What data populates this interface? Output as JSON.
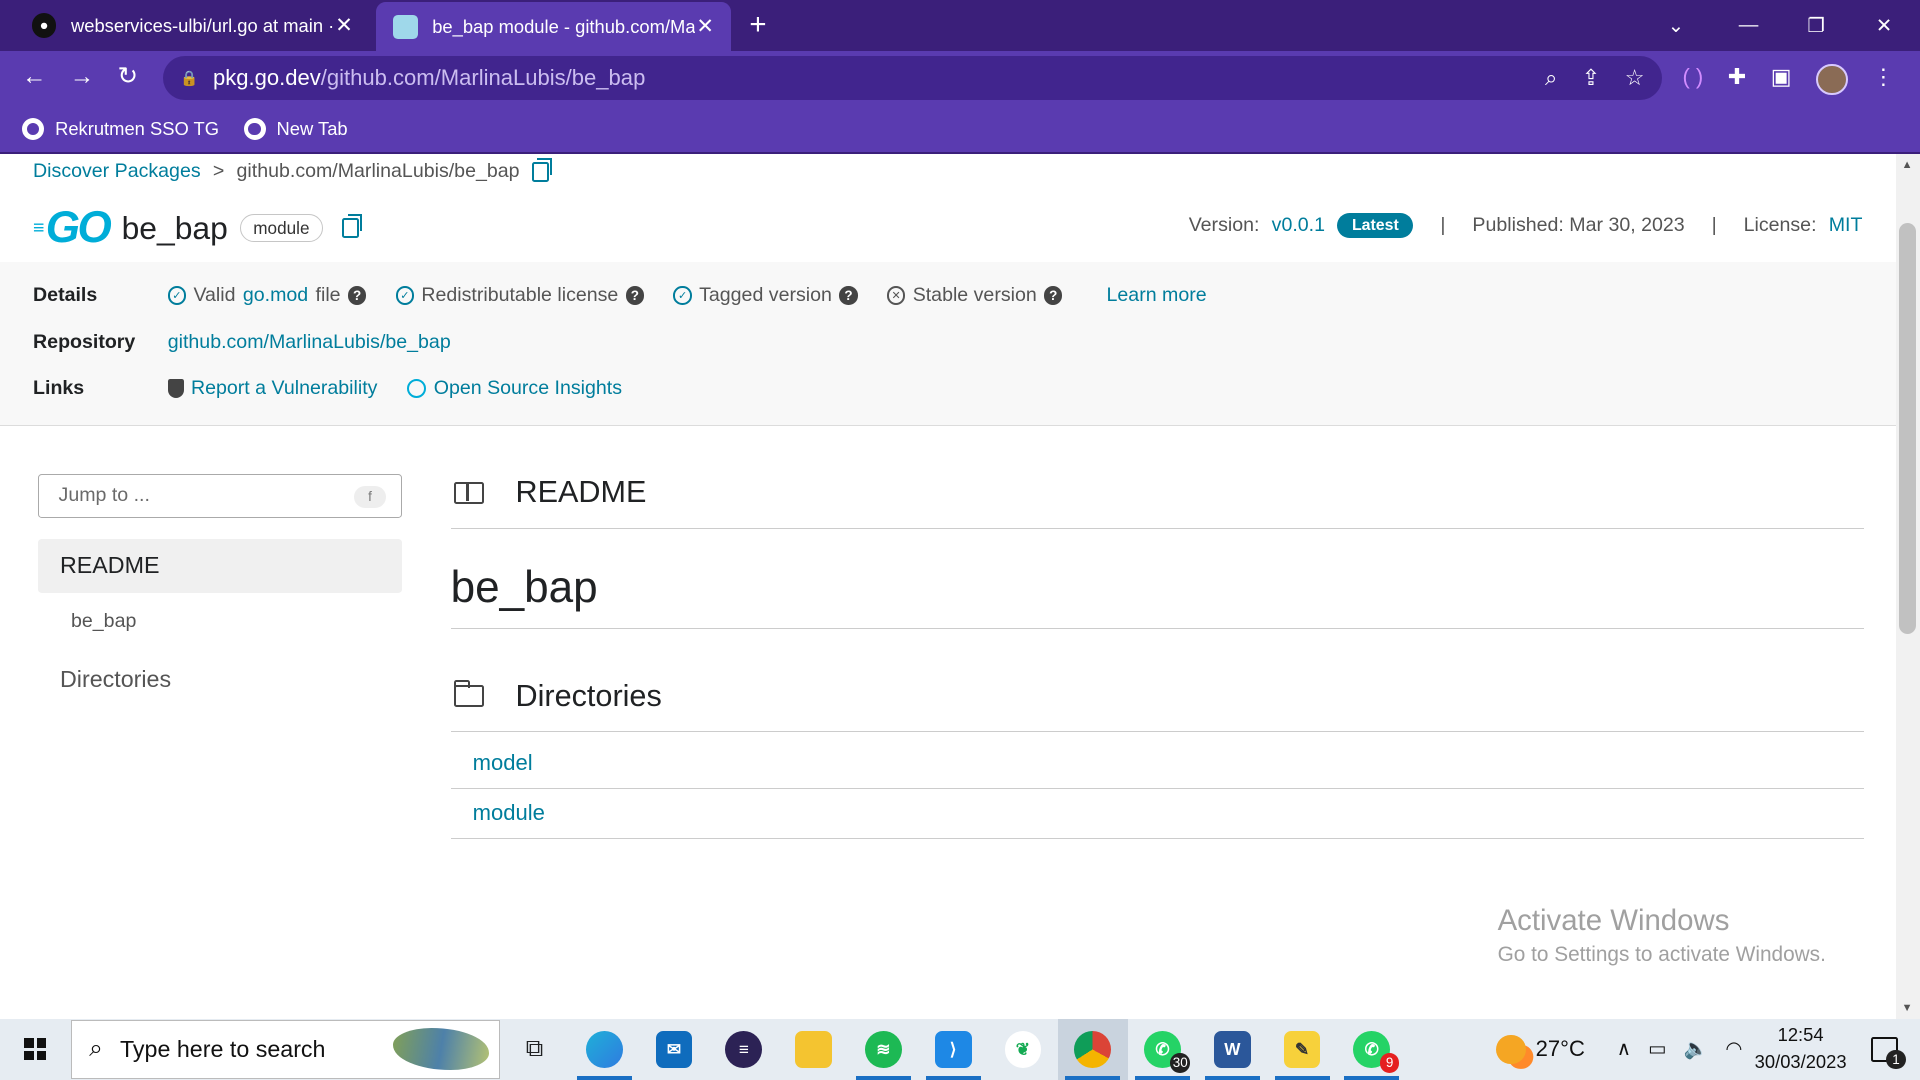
{
  "browser": {
    "tabs": [
      {
        "title": "webservices-ulbi/url.go at main ·",
        "close": "✕"
      },
      {
        "title": "be_bap module - github.com/Ma",
        "close": "✕"
      }
    ],
    "new_tab": "+",
    "url_host": "pkg.go.dev",
    "url_path": "/github.com/MarlinaLubis/be_bap",
    "bookmarks": [
      "Rekrutmen SSO TG",
      "New Tab"
    ]
  },
  "page": {
    "breadcrumb": {
      "root": "Discover Packages",
      "separator": ">",
      "current": "github.com/MarlinaLubis/be_bap"
    },
    "logo_text": "GO",
    "package_name": "be_bap",
    "badge": "module",
    "version_label": "Version:",
    "version": "v0.0.1",
    "latest": "Latest",
    "published": "Published: Mar 30, 2023",
    "license_label": "License:",
    "license": "MIT",
    "separator": "|",
    "details": {
      "label": "Details",
      "checks": [
        {
          "prefix": "Valid",
          "link": "go.mod",
          "suffix": "file"
        },
        {
          "text": "Redistributable license"
        },
        {
          "text": "Tagged version"
        },
        {
          "text": "Stable version"
        }
      ],
      "learn_more": "Learn more",
      "help": "?"
    },
    "repository": {
      "label": "Repository",
      "url": "github.com/MarlinaLubis/be_bap"
    },
    "links": {
      "label": "Links",
      "report": "Report a Vulnerability",
      "insights": "Open Source Insights"
    }
  },
  "sidebar": {
    "jump_placeholder": "Jump to ...",
    "jump_key": "f",
    "readme": "README",
    "readme_sub": "be_bap",
    "directories": "Directories"
  },
  "main": {
    "readme_title": "README",
    "h1": "be_bap",
    "directories_title": "Directories",
    "dirs": [
      "model",
      "module"
    ]
  },
  "watermark": {
    "line1": "Activate Windows",
    "line2": "Go to Settings to activate Windows."
  },
  "taskbar": {
    "search_placeholder": "Type here to search",
    "whatsapp_count": "30",
    "wa_business_count": "9",
    "temperature": "27°C",
    "time": "12:54",
    "date": "30/03/2023",
    "notifications": "1"
  }
}
